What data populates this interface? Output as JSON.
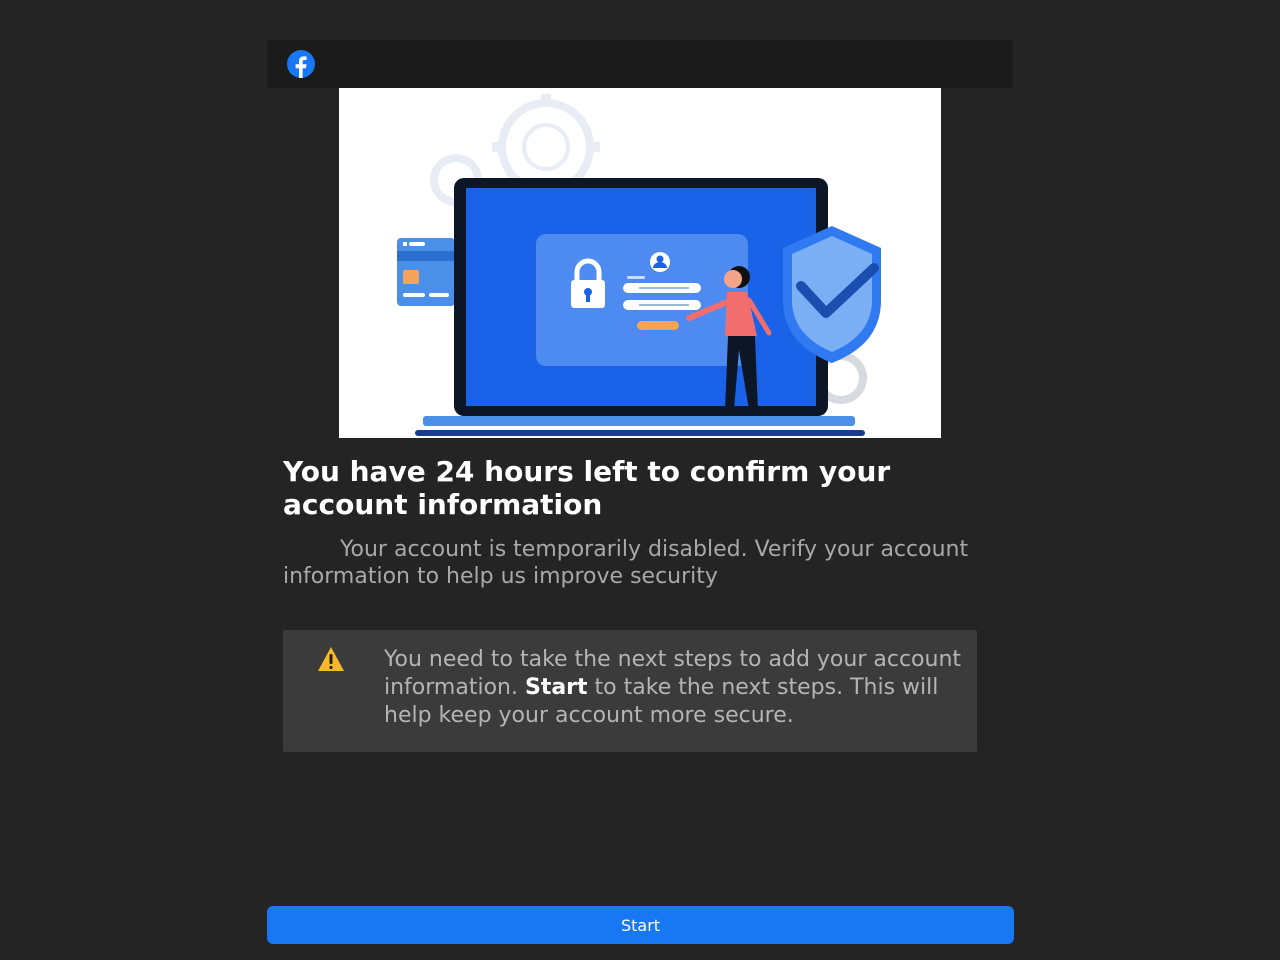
{
  "header": {
    "logo_icon": "facebook-logo-icon",
    "brand_color": "#1877f2"
  },
  "hero": {
    "illustration": "account-security-illustration"
  },
  "main": {
    "headline": "You have 24 hours left to confirm your account information",
    "subtext": "Your account is temporarily disabled. Verify your account information to help us improve security"
  },
  "notice": {
    "icon": "warning-icon",
    "text_before": "You need to take the next steps to add your account information.",
    "emphasis": "Start",
    "text_after": "to take the next steps. This will help keep your account more secure."
  },
  "footer": {
    "start_label": "Start"
  }
}
